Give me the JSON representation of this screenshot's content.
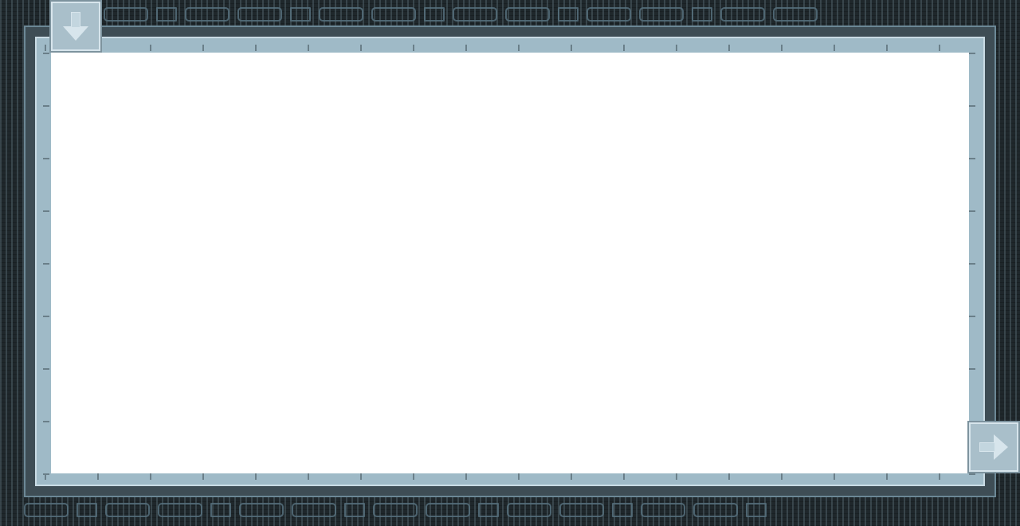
{
  "game": {
    "canvas_color": "#ffffff",
    "frame_colors": {
      "outer": "#1f272b",
      "mid": "#3e4d55",
      "inner": "#9fbac7",
      "accent": "#c9dbe4"
    }
  },
  "controls": {
    "down_button_icon": "arrow-down-icon",
    "right_button_icon": "arrow-right-icon"
  }
}
